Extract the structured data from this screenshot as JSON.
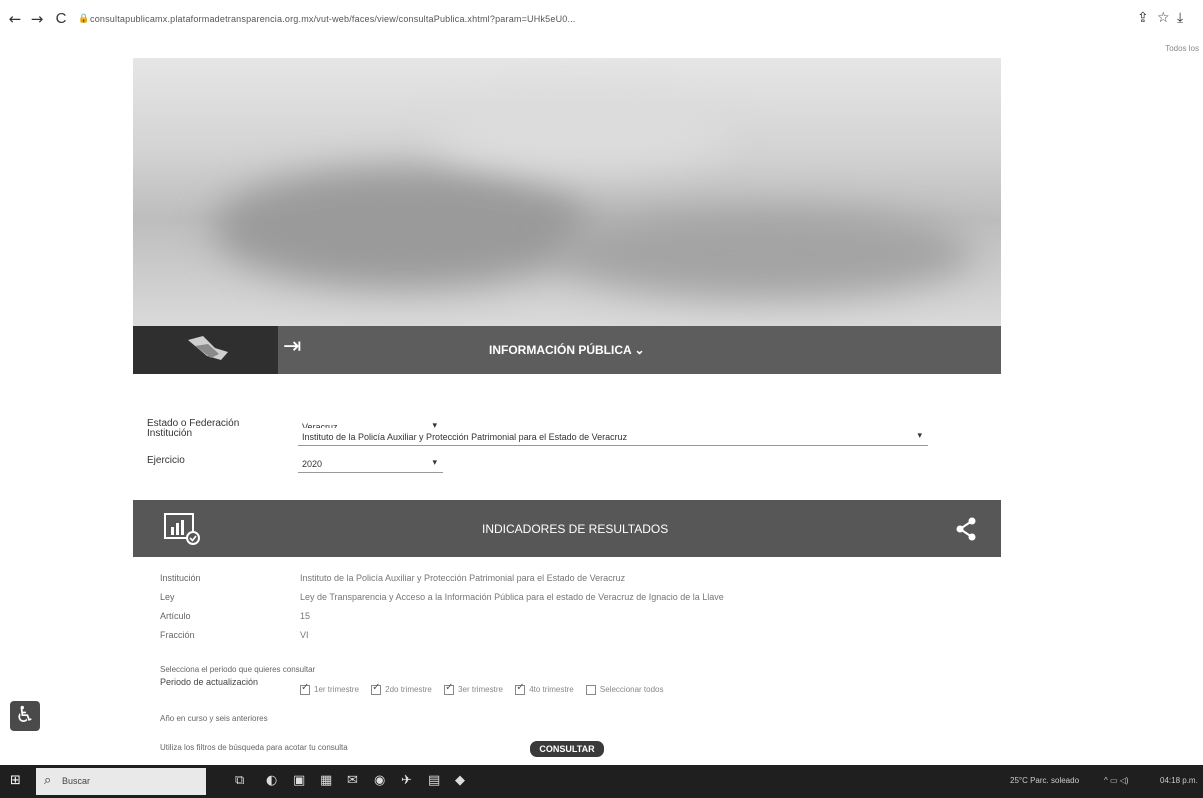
{
  "browser": {
    "url": "consultapublicamx.plataformadetransparencia.org.mx/vut-web/faces/view/consultaPublica.xhtml?param=UHk5eU0...",
    "back_icon": "←",
    "forward_icon": "→",
    "reload_icon": "C",
    "share_icon": "⇪",
    "star_icon": "☆",
    "download_icon": "⤓",
    "bookmarks_label": "Todos los"
  },
  "header_band": {
    "title": "INFORMACIÓN PÚBLICA ⌄",
    "login_icon": "⇥"
  },
  "filters": {
    "estado_label": "Estado o Federación",
    "estado_value": "Veracruz",
    "institucion_label": "Institución",
    "institucion_value": "Instituto de la Policía Auxiliar y Protección Patrimonial para el Estado de Veracruz",
    "ejercicio_label": "Ejercicio",
    "ejercicio_value": "2020"
  },
  "results_band": {
    "title": "INDICADORES DE RESULTADOS",
    "share_icon": "<"
  },
  "details": {
    "institucion_label": "Institución",
    "institucion_value": "Instituto de la Policía Auxiliar y Protección Patrimonial para el Estado de Veracruz",
    "ley_label": "Ley",
    "ley_value": "Ley de Transparencia y Acceso a la Información Pública para el estado de Veracruz de Ignacio de la Llave",
    "articulo_label": "Artículo",
    "articulo_value": "15",
    "fraccion_label": "Fracción",
    "fraccion_value": "VI"
  },
  "period": {
    "prompt": "Selecciona el periodo que quieres consultar",
    "label": "Periodo de actualización",
    "options": [
      "1er trimestre",
      "2do trimestre",
      "3er trimestre",
      "4to trimestre",
      "Seleccionar todos"
    ],
    "checked": [
      true,
      true,
      true,
      true,
      false
    ]
  },
  "notes": {
    "current_year": "Año en curso y seis anteriores",
    "filters_hint": "Utiliza los filtros de búsqueda para acotar tu consulta"
  },
  "consultar_label": "CONSULTAR",
  "taskbar": {
    "search_placeholder": "Buscar",
    "weather": "25°C  Parc. soleado",
    "clock": "04:18 p.m."
  }
}
